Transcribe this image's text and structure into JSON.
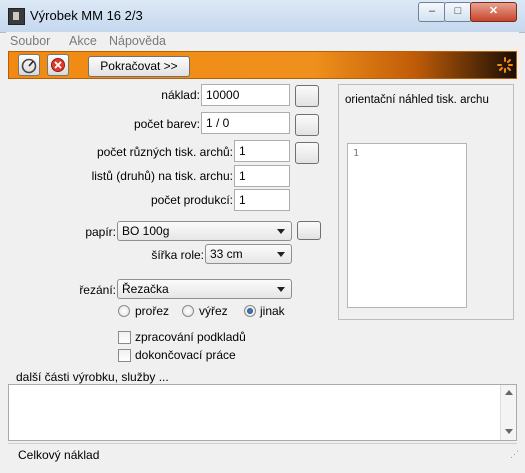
{
  "window": {
    "title": "Výrobek MM 16 2/3",
    "controls": [
      "minimize",
      "maximize",
      "close"
    ]
  },
  "menu": [
    "Soubor",
    "Akce",
    "Nápověda"
  ],
  "toolbar": {
    "continue_label": "Pokračovat >>"
  },
  "form": {
    "naklad_label": "náklad:",
    "naklad_value": "10000",
    "pocet_barev_label": "počet barev:",
    "pocet_barev_value": "1 / 0",
    "pocet_archu_label": "počet různých tisk. archů:",
    "pocet_archu_value": "1",
    "listu_label": "listů (druhů) na tisk. archu:",
    "listu_value": "1",
    "produkci_label": "počet produkcí:",
    "produkci_value": "1",
    "papir_label": "papír:",
    "papir_value": "BO 100g",
    "sirka_label": "šířka role:",
    "sirka_value": "33 cm",
    "rezani_label": "řezání:",
    "rezani_value": "Řezačka",
    "radios": [
      {
        "label": "prořez",
        "checked": false
      },
      {
        "label": "výřez",
        "checked": false
      },
      {
        "label": "jinak",
        "checked": true
      }
    ],
    "checkboxes": [
      {
        "label": "zpracování podkladů",
        "checked": false
      },
      {
        "label": "dokončovací práce",
        "checked": false
      }
    ]
  },
  "preview": {
    "title": "orientační náhled tisk. archu",
    "content": "1"
  },
  "extra_label": "další části výrobku, služby ...",
  "status": "Celkový náklad"
}
